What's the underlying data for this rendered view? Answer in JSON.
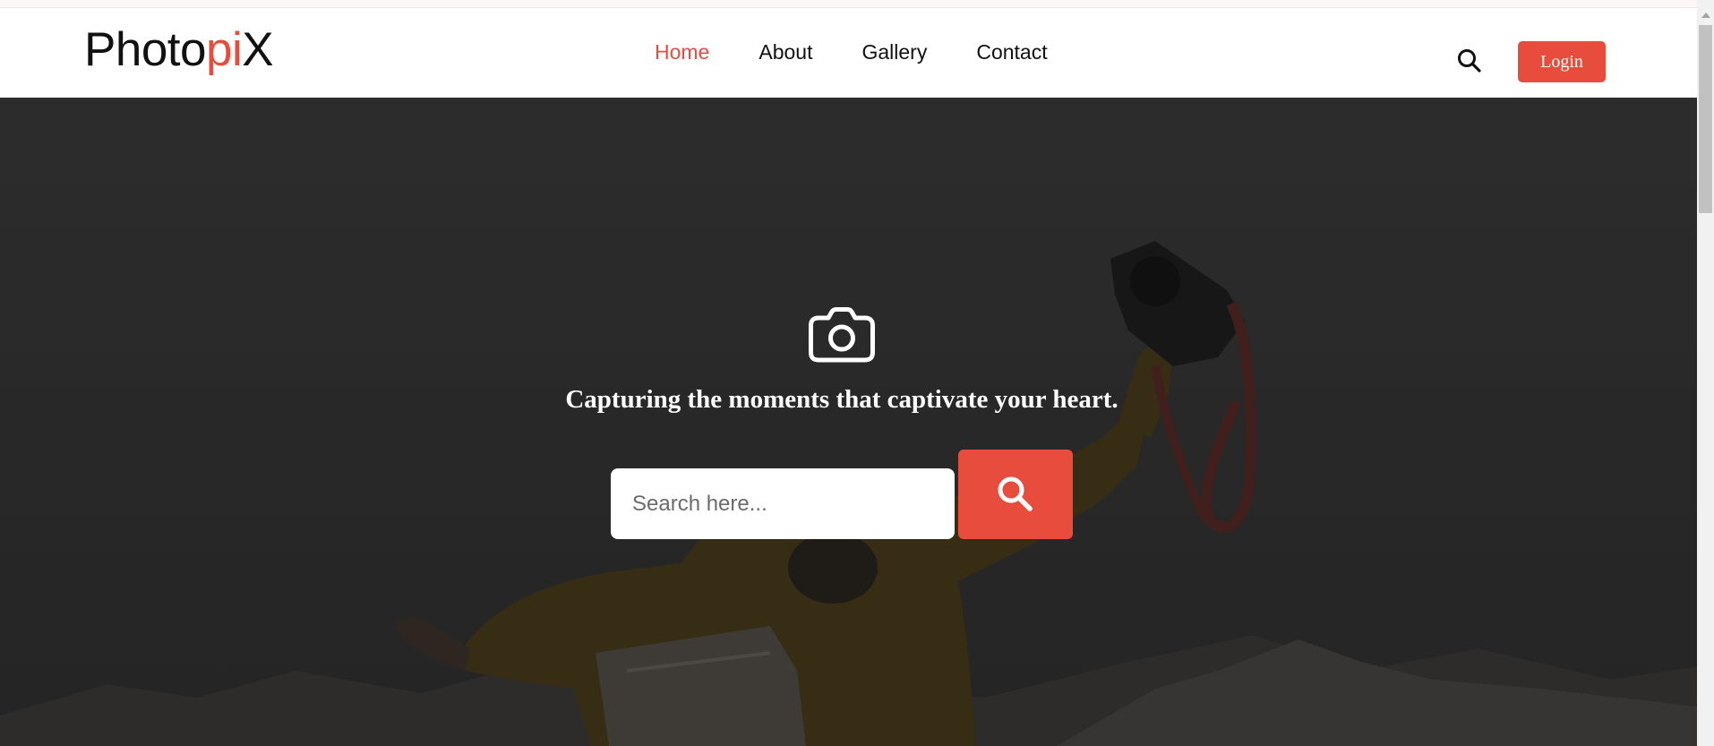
{
  "logo": {
    "part1": "Photo",
    "part2": "pi",
    "part3": "X"
  },
  "nav": {
    "items": [
      {
        "label": "Home",
        "active": true
      },
      {
        "label": "About",
        "active": false
      },
      {
        "label": "Gallery",
        "active": false
      },
      {
        "label": "Contact",
        "active": false
      }
    ],
    "search_icon": "search-icon",
    "login_label": "Login"
  },
  "hero": {
    "icon": "camera-icon",
    "tagline": "Capturing the moments that captivate your heart.",
    "search": {
      "placeholder": "Search here...",
      "value": "",
      "button_icon": "search-icon"
    }
  },
  "colors": {
    "accent": "#e74c3c",
    "text": "#111111",
    "overlay": "#333333"
  }
}
